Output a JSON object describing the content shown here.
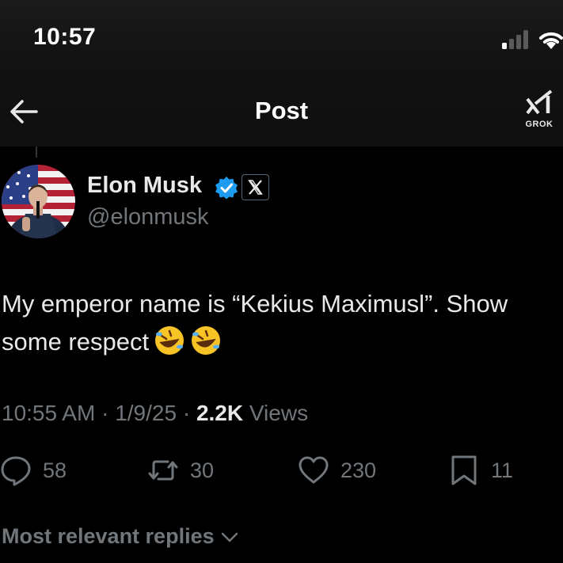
{
  "status_bar": {
    "time": "10:57",
    "signal_icon": "cellular-signal-icon",
    "wifi_icon": "wifi-icon"
  },
  "header": {
    "title": "Post",
    "back_icon": "back-arrow-icon",
    "grok_label": "GROK",
    "grok_icon": "grok-logo-icon"
  },
  "post": {
    "author_name": "Elon Musk",
    "handle": "@elonmusk",
    "verified_icon": "verified-badge-icon",
    "affiliate_icon": "x-logo-icon",
    "text_line1": "My emperor name is “Kekius Maximusl”. Show",
    "text_line2": "some respect",
    "emoji": "🤣",
    "time": "10:55 AM",
    "date": "1/9/25",
    "views_count": "2.2K",
    "views_label": "Views",
    "separator": " · "
  },
  "actions": {
    "replies": "58",
    "reposts": "30",
    "likes": "230",
    "bookmarks": "11"
  },
  "replies_sort": {
    "label": "Most relevant replies",
    "icon": "chevron-down-icon"
  },
  "colors": {
    "background": "#000000",
    "text": "#e7e9ea",
    "muted": "#71767b",
    "verified": "#1d9bf0"
  }
}
